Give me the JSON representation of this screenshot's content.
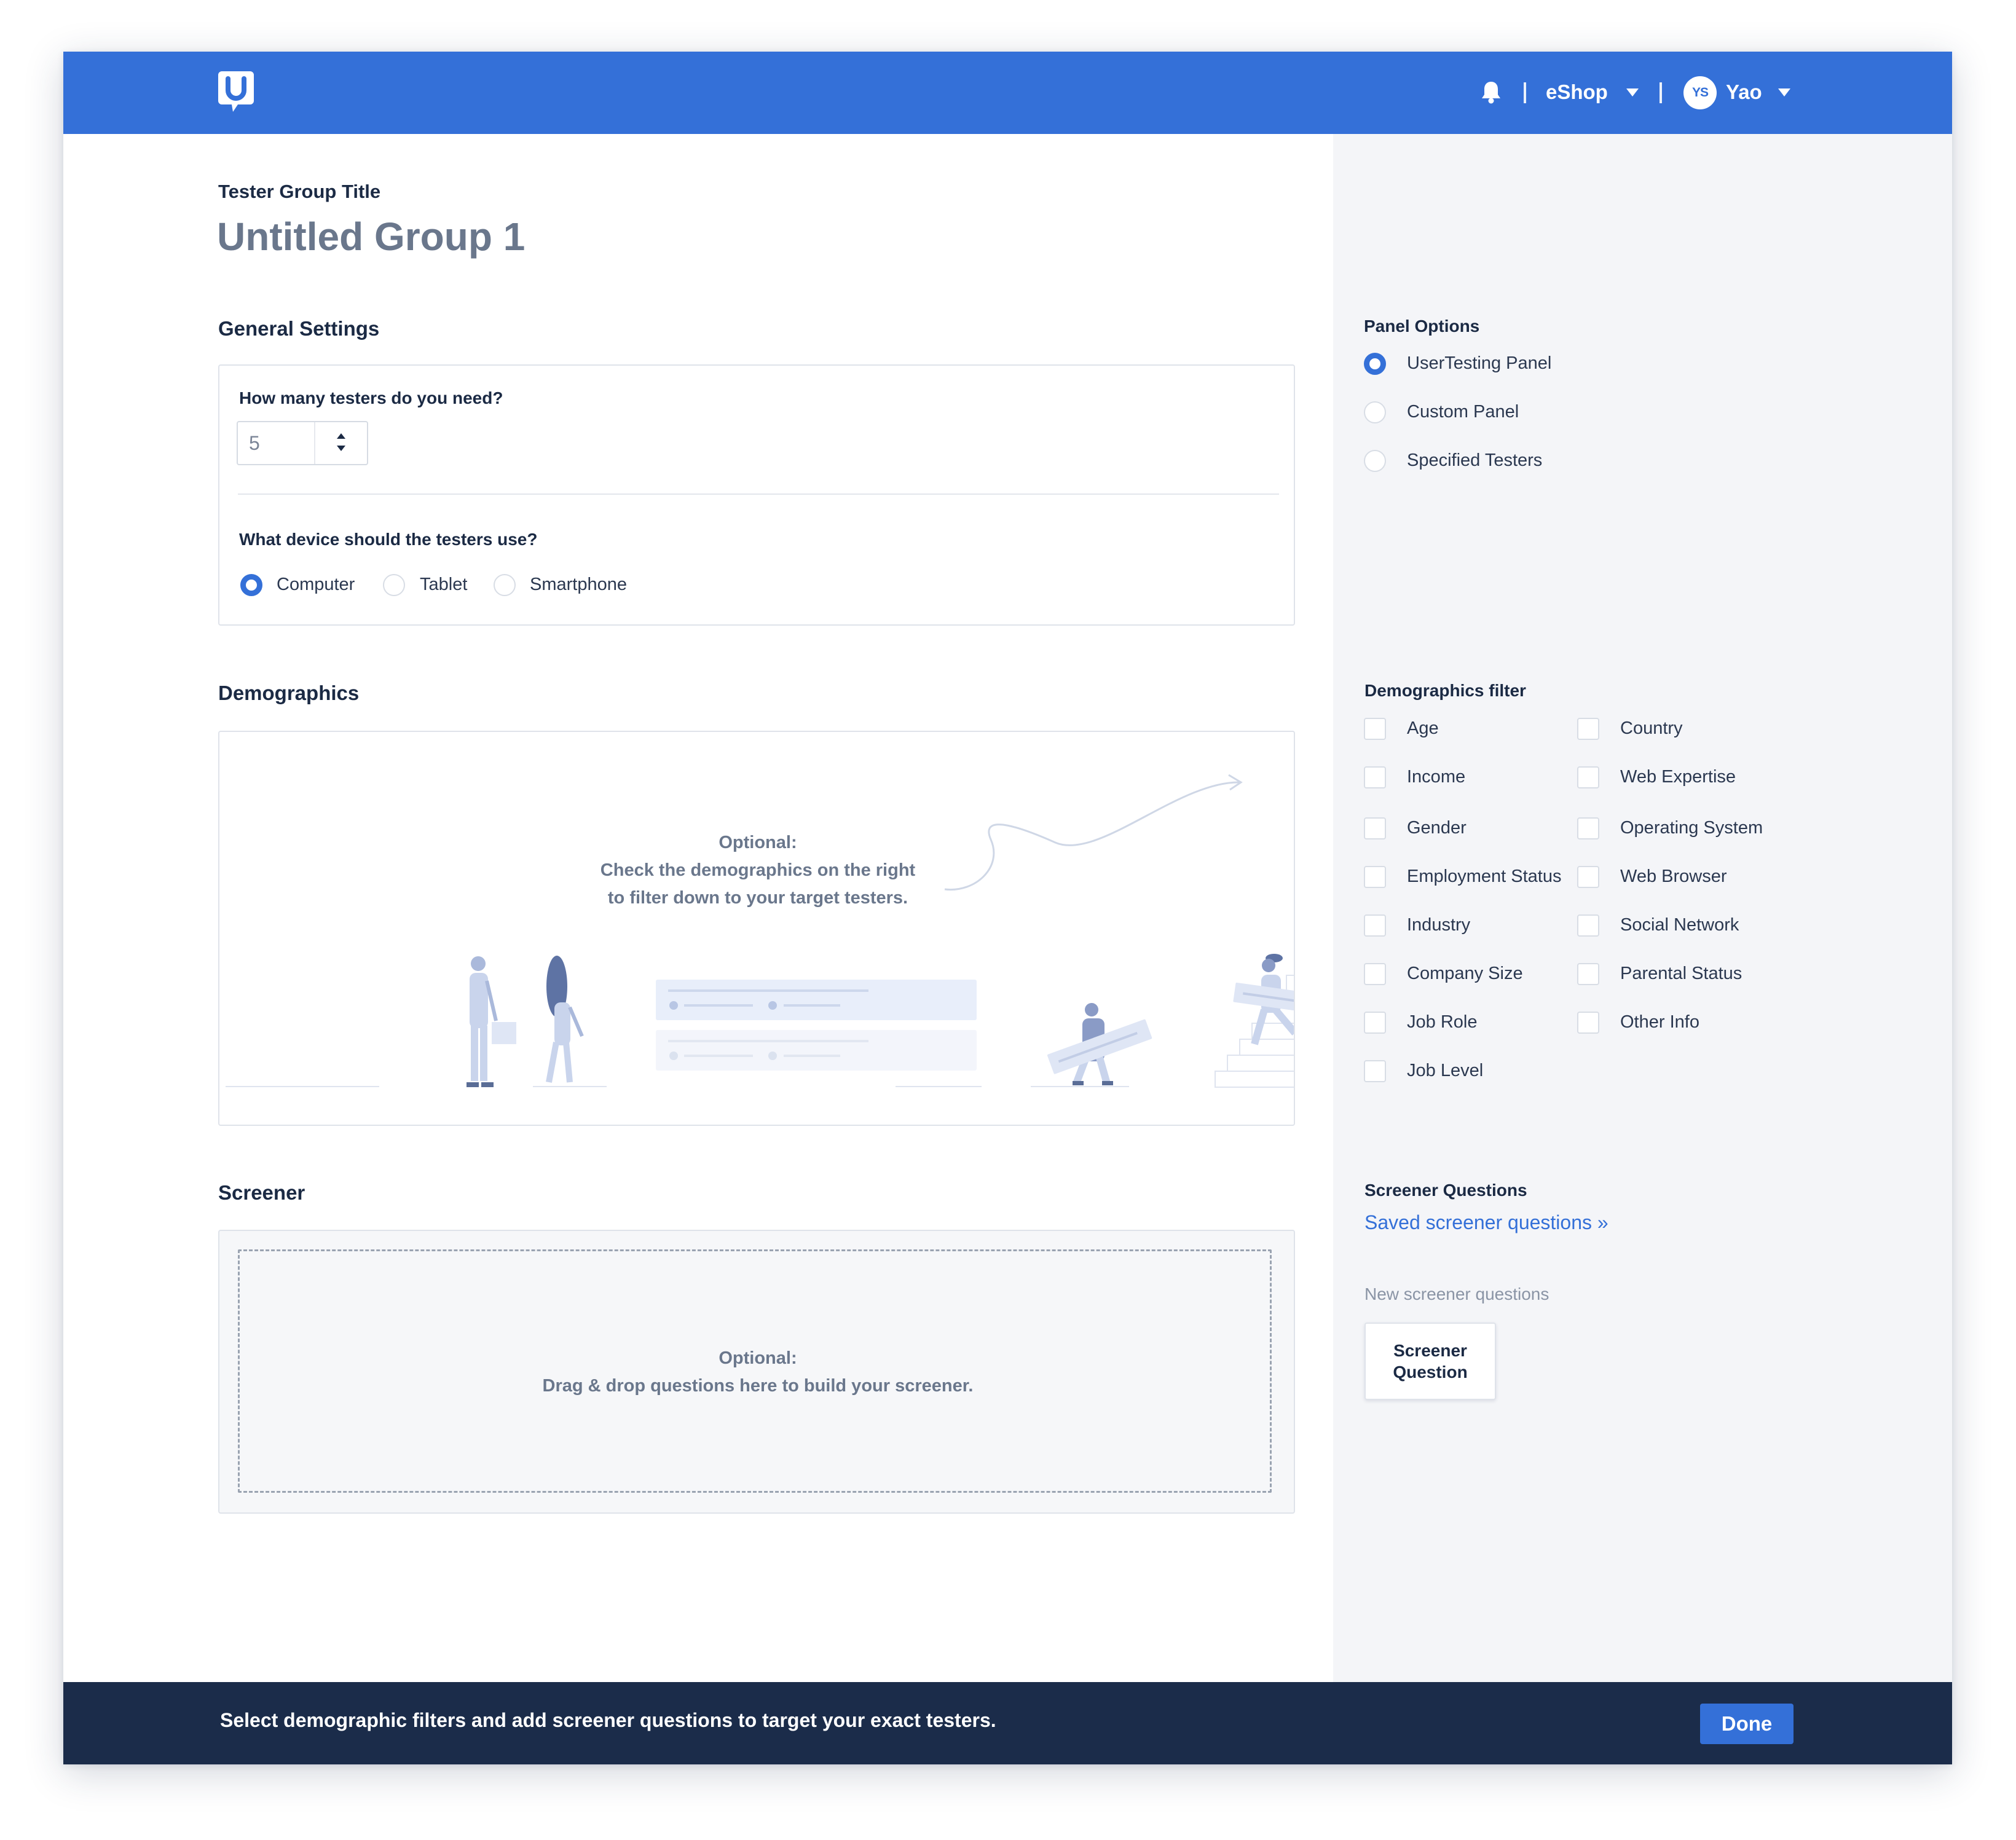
{
  "header": {
    "account": "eShop",
    "user_initials": "YS",
    "user_name": "Yao"
  },
  "group": {
    "title_label": "Tester Group Title",
    "title": "Untitled Group 1"
  },
  "general": {
    "heading": "General Settings",
    "testers_question": "How many testers do you need?",
    "testers_value": "5",
    "device_question": "What device should the testers use?",
    "devices": [
      {
        "label": "Computer",
        "selected": true
      },
      {
        "label": "Tablet",
        "selected": false
      },
      {
        "label": "Smartphone",
        "selected": false
      }
    ]
  },
  "demographics": {
    "heading": "Demographics",
    "hint_title": "Optional:",
    "hint_line1": "Check the demographics on the right",
    "hint_line2": "to filter down to your target testers."
  },
  "screener": {
    "heading": "Screener",
    "hint_title": "Optional:",
    "hint_text": "Drag & drop questions here to build your screener."
  },
  "panel_options": {
    "heading": "Panel Options",
    "options": [
      {
        "label": "UserTesting Panel",
        "selected": true
      },
      {
        "label": "Custom Panel",
        "selected": false
      },
      {
        "label": "Specified Testers",
        "selected": false
      }
    ]
  },
  "demographics_filter": {
    "heading": "Demographics filter",
    "left": [
      "Age",
      "Income",
      "Gender",
      "Employment Status",
      "Industry",
      "Company Size",
      "Job Role",
      "Job Level"
    ],
    "right": [
      "Country",
      "Web Expertise",
      "Operating System",
      "Web Browser",
      "Social Network",
      "Parental Status",
      "Other Info"
    ]
  },
  "screener_questions": {
    "heading": "Screener Questions",
    "saved_link": "Saved screener questions »",
    "new_label": "New screener questions",
    "button": "Screener Question"
  },
  "footer": {
    "message": "Select demographic filters and add screener questions to target your exact testers.",
    "done": "Done"
  },
  "colors": {
    "brand_blue": "#3470d8",
    "footer_navy": "#1b2c4a",
    "panel_gray": "#f4f5f8"
  },
  "icons": [
    "usertesting-logo-icon",
    "bell-icon",
    "chevron-down-icon"
  ]
}
